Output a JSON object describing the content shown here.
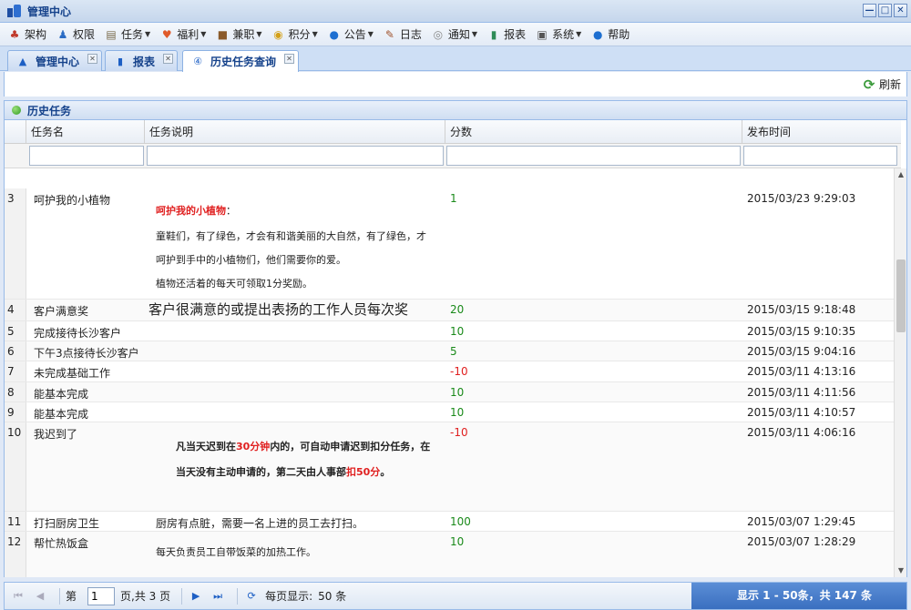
{
  "window": {
    "title": "管理中心",
    "buttons": [
      "—",
      "□",
      "✕"
    ]
  },
  "menu": [
    {
      "label": "架构",
      "icon": "org-chart-icon",
      "glyph": "♣",
      "color": "#c0392b",
      "dropdown": false
    },
    {
      "label": "权限",
      "icon": "user-key-icon",
      "glyph": "♟",
      "color": "#2b6cc4",
      "dropdown": false
    },
    {
      "label": "任务",
      "icon": "clipboard-icon",
      "glyph": "▤",
      "color": "#7a6a4a",
      "dropdown": true
    },
    {
      "label": "福利",
      "icon": "heart-icon",
      "glyph": "♥",
      "color": "#e05a2a",
      "dropdown": true
    },
    {
      "label": "兼职",
      "icon": "briefcase-icon",
      "glyph": "■",
      "color": "#8a5a2a",
      "dropdown": true
    },
    {
      "label": "积分",
      "icon": "coins-icon",
      "glyph": "◉",
      "color": "#d4a017",
      "dropdown": true
    },
    {
      "label": "公告",
      "icon": "info-icon",
      "glyph": "●",
      "color": "#1d6fd1",
      "dropdown": true
    },
    {
      "label": "日志",
      "icon": "pencil-icon",
      "glyph": "✎",
      "color": "#a0522d",
      "dropdown": false
    },
    {
      "label": "通知",
      "icon": "speaker-icon",
      "glyph": "◎",
      "color": "#888888",
      "dropdown": true
    },
    {
      "label": "报表",
      "icon": "bar-chart-icon",
      "glyph": "▮",
      "color": "#2e8b57",
      "dropdown": false
    },
    {
      "label": "系统",
      "icon": "computer-icon",
      "glyph": "▣",
      "color": "#555555",
      "dropdown": true
    },
    {
      "label": "帮助",
      "icon": "help-icon",
      "glyph": "●",
      "color": "#1d6fd1",
      "dropdown": false
    }
  ],
  "tabs": [
    {
      "label": "管理中心",
      "icon": "home-icon",
      "glyph": "▲",
      "active": false
    },
    {
      "label": "报表",
      "icon": "bar-chart-icon",
      "glyph": "▮",
      "active": false
    },
    {
      "label": "历史任务查询",
      "icon": "clock-icon",
      "glyph": "④",
      "active": true
    }
  ],
  "toolbar": {
    "refresh_label": "刷新"
  },
  "panel": {
    "title": "历史任务"
  },
  "columns": [
    "任务名",
    "任务说明",
    "分数",
    "发布时间"
  ],
  "rows": [
    {
      "num": "3",
      "name": "呵护我的小植物",
      "score": "1",
      "score_type": "pos",
      "time": "2015/03/23 9:29:03",
      "desc_lines": [
        {
          "text": "呵护我的小植物：",
          "red": "呵护我的小植物"
        },
        {
          "text": "童鞋们，有了绿色，才会有和谐美丽的大自然，有了绿色，才"
        },
        {
          "text": "呵护到手中的小植物们，他们需要你的爱。"
        },
        {
          "text": "植物还活着的每天可领取1分奖励。"
        }
      ]
    },
    {
      "num": "4",
      "name": "客户满意奖",
      "score": "20",
      "score_type": "pos",
      "time": "2015/03/15 9:18:48",
      "desc_big": "客户很满意的或提出表扬的工作人员每次奖"
    },
    {
      "num": "5",
      "name": "完成接待长沙客户",
      "score": "10",
      "score_type": "pos",
      "time": "2015/03/15 9:10:35"
    },
    {
      "num": "6",
      "name": "下午3点接待长沙客户",
      "score": "5",
      "score_type": "pos",
      "time": "2015/03/15 9:04:16"
    },
    {
      "num": "7",
      "name": "未完成基础工作",
      "score": "-10",
      "score_type": "neg",
      "time": "2015/03/11 4:13:16"
    },
    {
      "num": "8",
      "name": "能基本完成",
      "score": "10",
      "score_type": "pos",
      "time": "2015/03/11 4:11:56"
    },
    {
      "num": "9",
      "name": "能基本完成",
      "score": "10",
      "score_type": "pos",
      "time": "2015/03/11 4:10:57"
    },
    {
      "num": "10",
      "name": "我迟到了",
      "score": "-10",
      "score_type": "neg",
      "time": "2015/03/11 4:06:16",
      "desc_rich": [
        {
          "parts": [
            "凡当天迟到在",
            "30分钟",
            "内的，可自动申请迟到扣分任务，在"
          ]
        },
        {
          "parts": [
            "当天没有主动申请的，第二天由人事部",
            "扣50分",
            "。"
          ]
        }
      ]
    },
    {
      "num": "11",
      "name": "打扫厨房卫生",
      "score": "100",
      "score_type": "pos",
      "time": "2015/03/07 1:29:45",
      "desc": "厨房有点脏，需要一名上进的员工去打扫。"
    },
    {
      "num": "12",
      "name": "帮忙热饭盒",
      "score": "10",
      "score_type": "pos",
      "time": "2015/03/07 1:28:29",
      "desc_lines": [
        {
          "text": "每天负责员工自带饭菜的加热工作。"
        }
      ]
    }
  ],
  "pager": {
    "page_prefix": "第",
    "current_page": "1",
    "page_suffix": "页,共 3 页",
    "per_page_label": "每页显示:",
    "per_page_value": "50 条",
    "summary": "显示 1 - 50条，共 147 条"
  }
}
